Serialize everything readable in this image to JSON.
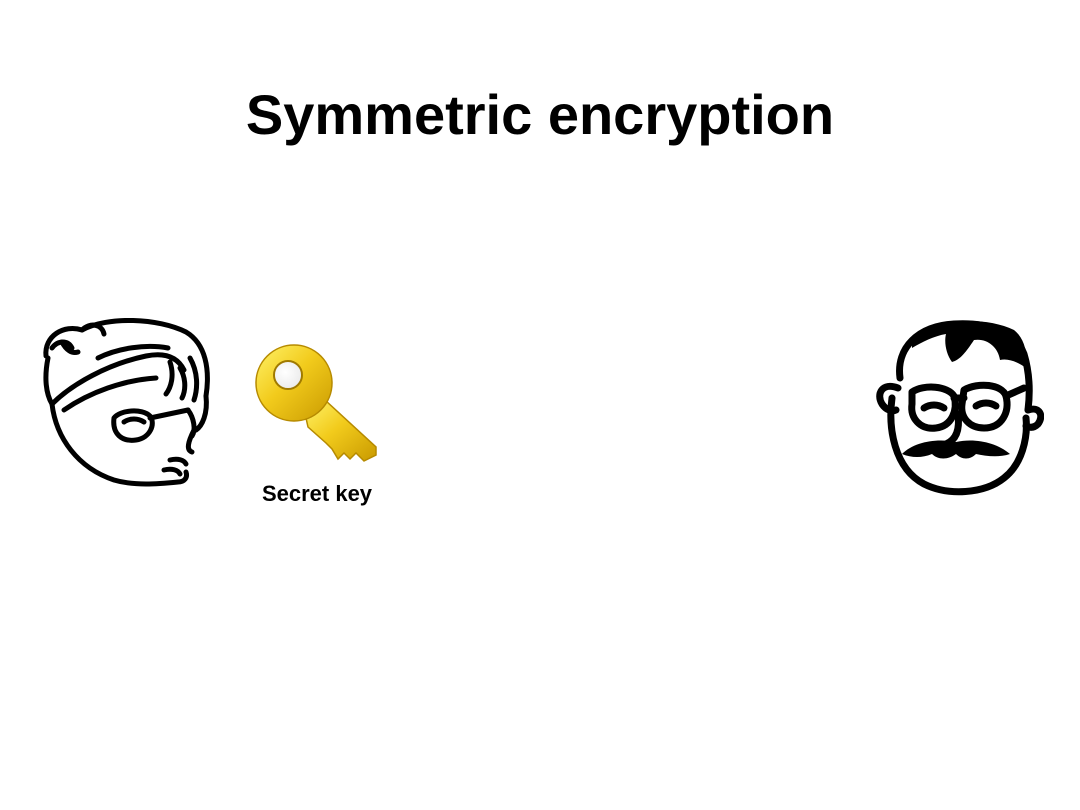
{
  "slide": {
    "title": "Symmetric encryption"
  },
  "key": {
    "label": "Secret key",
    "icon": "key-icon",
    "color": "#e2b300"
  },
  "people": [
    {
      "icon": "alice-face-icon"
    },
    {
      "icon": "bob-face-icon"
    }
  ]
}
